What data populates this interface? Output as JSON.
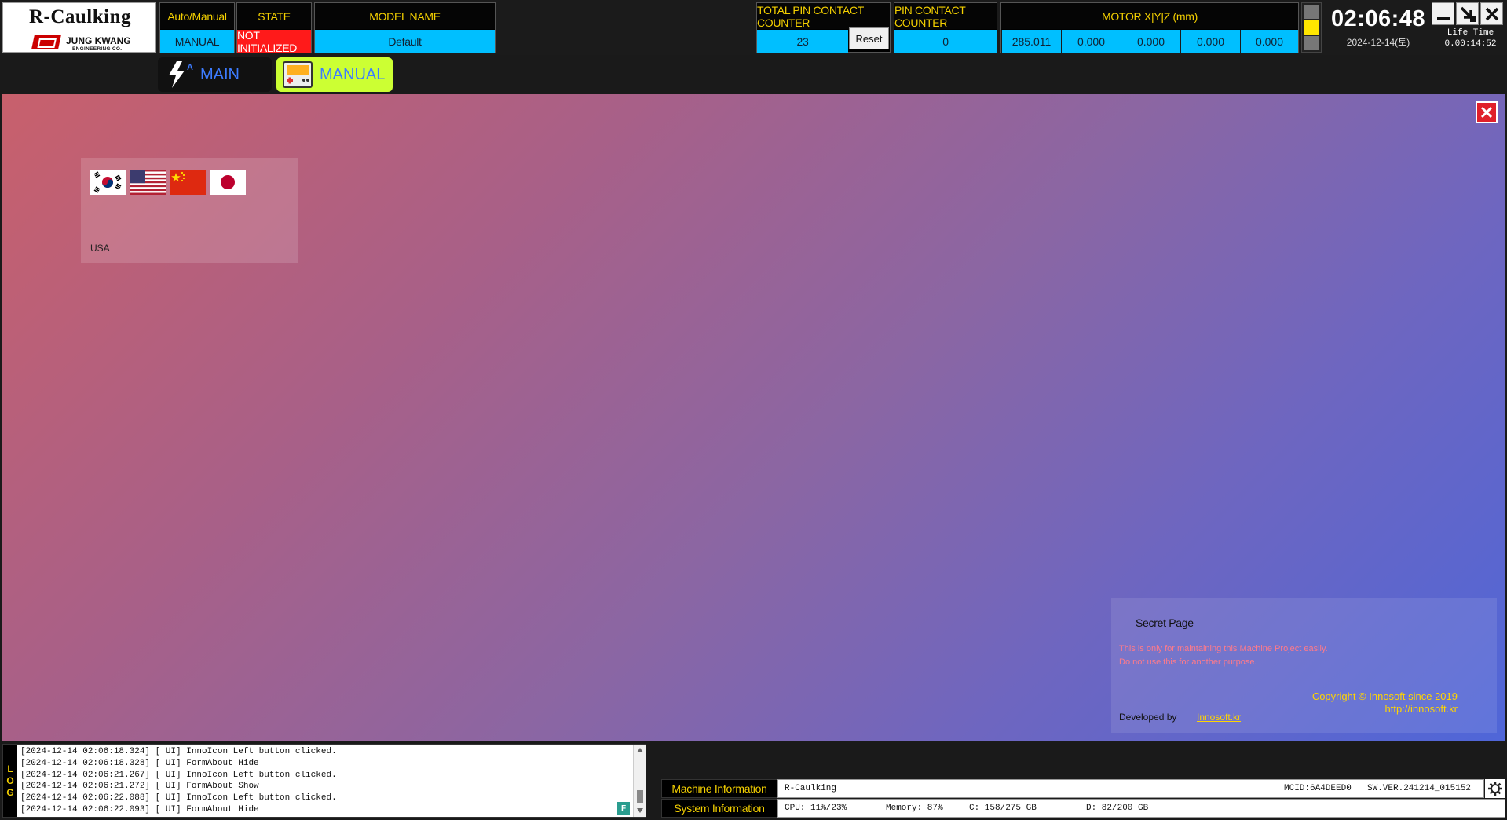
{
  "logo": {
    "title": "R-Caulking",
    "company": "JUNG KWANG",
    "company_sub": "ENGINEERING CO."
  },
  "header": {
    "mode": {
      "label": "Auto/Manual",
      "value": "MANUAL"
    },
    "state": {
      "label": "STATE",
      "value": "NOT INITIALIZED"
    },
    "model": {
      "label": "MODEL NAME",
      "value": "Default"
    },
    "total_pin": {
      "label": "TOTAL PIN CONTACT COUNTER",
      "value": "23",
      "reset_label": "Reset"
    },
    "pin": {
      "label": "PIN CONTACT COUNTER",
      "value": "0"
    },
    "motor": {
      "label": "MOTOR X|Y|Z (mm)",
      "values": [
        "285.011",
        "0.000",
        "0.000",
        "0.000",
        "0.000"
      ]
    },
    "status_colors": [
      "#777777",
      "#ffe600",
      "#777777"
    ],
    "clock": "02:06:48",
    "date": "2024-12-14(토)",
    "life_time_label": "Life Time",
    "life_time_value": "0.00:14:52"
  },
  "tabs": [
    {
      "label": "MAIN",
      "icon": "bolt-auto-icon",
      "active": false
    },
    {
      "label": "MANUAL",
      "icon": "gamepad-icon",
      "active": true
    }
  ],
  "language": {
    "flags": [
      "flag-korea-icon",
      "flag-usa-icon",
      "flag-china-icon",
      "flag-japan-icon"
    ],
    "selected": "USA"
  },
  "secret": {
    "title": "Secret Page",
    "warning1": "This is only for maintaining this Machine Project easily.",
    "warning2": "Do not use this for another purpose.",
    "copyright": "Copyright © Innosoft since 2019",
    "url": "http://innosoft.kr",
    "developed_by": "Developed by",
    "link": "Innosoft.kr"
  },
  "log": {
    "tag": [
      "L",
      "O",
      "G"
    ],
    "lines": [
      "[2024-12-14 02:06:18.324] [ UI] InnoIcon Left button clicked.",
      "[2024-12-14 02:06:18.328] [ UI] FormAbout Hide",
      "[2024-12-14 02:06:21.267] [ UI] InnoIcon Left button clicked.",
      "[2024-12-14 02:06:21.272] [ UI] FormAbout Show",
      "[2024-12-14 02:06:22.088] [ UI] InnoIcon Left button clicked.",
      "[2024-12-14 02:06:22.093] [ UI] FormAbout Hide"
    ],
    "filter_label": "F"
  },
  "machine_info": {
    "label": "Machine Information",
    "name": "R-Caulking",
    "mcid": "MCID:6A4DEED0",
    "sw_ver": "SW.VER.241214_015152"
  },
  "system_info": {
    "label": "System Information",
    "cpu": "CPU: 11%/23%",
    "memory": "Memory: 87%",
    "disk_c": "C: 158/275 GB",
    "disk_d": "D: 82/200 GB"
  },
  "colors": {
    "accent_yellow": "#f4d000",
    "cyan": "#00bfff",
    "alert_red": "#ff1a1a",
    "manual_tab": "#ccff33"
  }
}
